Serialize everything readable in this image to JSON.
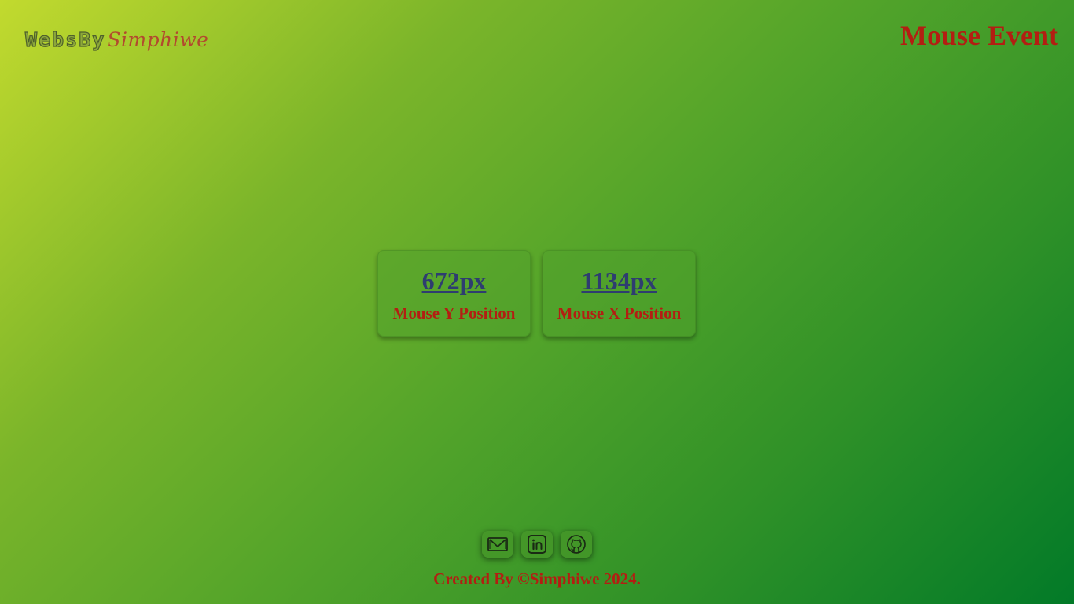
{
  "header": {
    "logo_main": "WebsBy",
    "logo_script": "Simphiwe",
    "title": "Mouse Event"
  },
  "cards": [
    {
      "value": "672px",
      "label": "Mouse Y Position"
    },
    {
      "value": "1134px",
      "label": "Mouse X Position"
    }
  ],
  "socials": [
    {
      "icon": "gmail-icon"
    },
    {
      "icon": "linkedin-icon"
    },
    {
      "icon": "github-icon"
    }
  ],
  "footer": {
    "text": "Created By ©Simphiwe 2024."
  },
  "colors": {
    "accent_red": "#b31e12",
    "value_blue": "#2e3d70",
    "gradient_start": "#c2da2e",
    "gradient_end": "#027a28"
  }
}
